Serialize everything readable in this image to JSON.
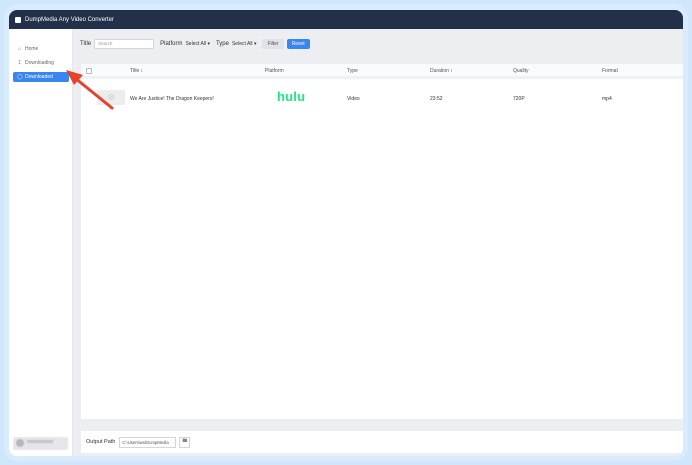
{
  "app": {
    "title": "DumpMedia Any Video Converter"
  },
  "sidebar": {
    "items": [
      {
        "label": "Home",
        "icon": "home-icon",
        "active": false
      },
      {
        "label": "Downloading",
        "icon": "download-icon",
        "active": false
      },
      {
        "label": "Downloaded",
        "icon": "clock-icon",
        "active": true
      }
    ]
  },
  "filters": {
    "title_label": "Title",
    "search_placeholder": "Search",
    "platform_label": "Platform",
    "platform_value": "Select All",
    "type_label": "Type",
    "type_value": "Select All",
    "filter_button": "Filter",
    "reset_button": "Reset"
  },
  "table": {
    "headers": {
      "title": "Title ↕",
      "platform": "Platform",
      "type": "Type",
      "duration": "Duration ↕",
      "quality": "Quality",
      "format": "Format"
    },
    "rows": [
      {
        "title": "We Are Justice! The Dragon Keepers!",
        "platform": "hulu",
        "type": "Video",
        "duration": "23:52",
        "quality": "720P",
        "format": "mp4"
      }
    ]
  },
  "footer": {
    "output_label": "Output Path",
    "output_path": "C:\\Users\\ws\\DumpMedia"
  },
  "colors": {
    "accent": "#3a86f0",
    "titlebar": "#223049",
    "hulu": "#1ce783",
    "annotation_arrow": "#e8412c"
  }
}
